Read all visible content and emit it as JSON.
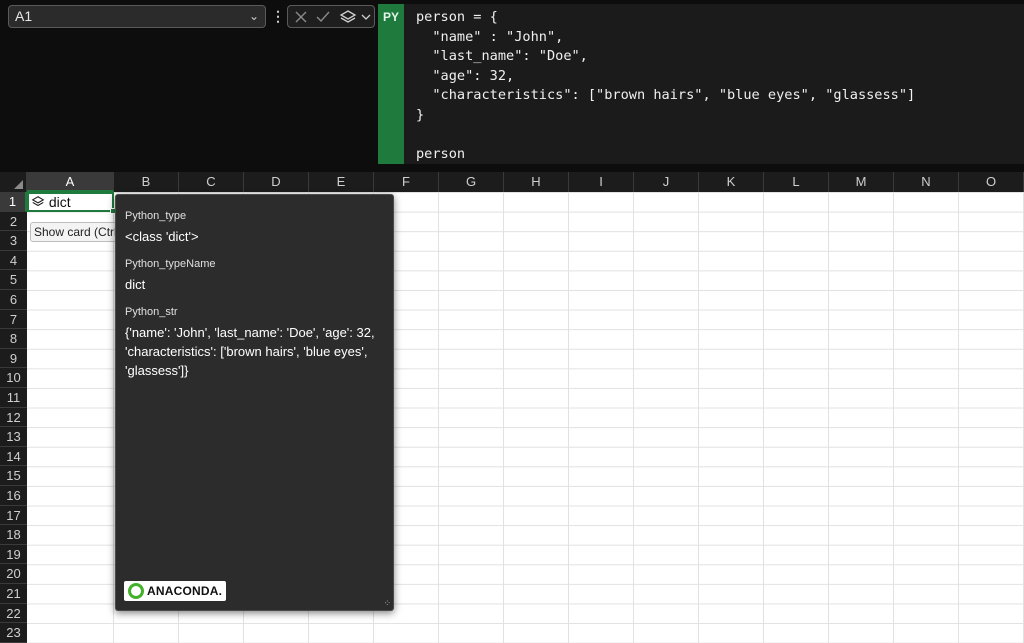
{
  "formula_bar": {
    "name_box": "A1",
    "py_badge": "PY",
    "code": "person = {\n  \"name\" : \"John\",\n  \"last_name\": \"Doe\",\n  \"age\": 32,\n  \"characteristics\": [\"brown hairs\", \"blue eyes\", \"glassess\"]\n}\n\nperson"
  },
  "grid": {
    "columns": [
      "A",
      "B",
      "C",
      "D",
      "E",
      "F",
      "G",
      "H",
      "I",
      "J",
      "K",
      "L",
      "M",
      "N",
      "O"
    ],
    "rows": [
      "1",
      "2",
      "3",
      "4",
      "5",
      "6",
      "7",
      "8",
      "9",
      "10",
      "11",
      "12",
      "13",
      "14",
      "15",
      "16",
      "17",
      "18",
      "19",
      "20",
      "21",
      "22",
      "23"
    ],
    "selected_column": "A",
    "selected_row": "1",
    "cell_a1_value": "dict",
    "cell_a1_icon": "python-object-icon"
  },
  "show_card_tooltip": "Show card (Ctrl",
  "card": {
    "fields": [
      {
        "label": "Python_type",
        "value": "<class 'dict'>"
      },
      {
        "label": "Python_typeName",
        "value": "dict"
      },
      {
        "label": "Python_str",
        "value": "{'name': 'John', 'last_name': 'Doe', 'age': 32, 'characteristics': ['brown hairs', 'blue eyes', 'glassess']}"
      }
    ],
    "logo_text": "ANACONDA."
  },
  "colors": {
    "accent_green": "#1f7a3d",
    "anaconda_green": "#43b02a",
    "card_bg": "#2c2c2c"
  }
}
